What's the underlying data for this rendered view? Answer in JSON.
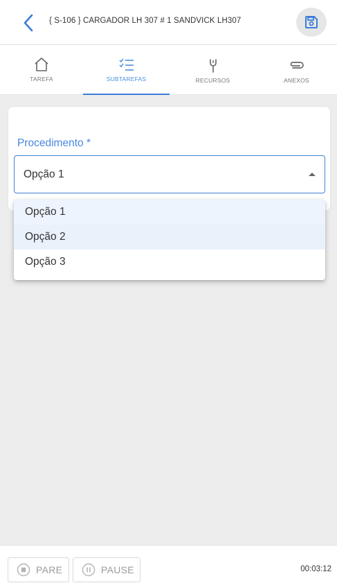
{
  "header": {
    "title": "{ S-106 } CARGADOR LH 307 # 1 SANDVICK LH307"
  },
  "tabs": [
    {
      "label": "TAREFA",
      "icon": "home-icon"
    },
    {
      "label": "SUBTAREFAS",
      "icon": "checklist-icon"
    },
    {
      "label": "RECURSOS",
      "icon": "wrench-icon"
    },
    {
      "label": "ANEXOS",
      "icon": "paperclip-icon"
    }
  ],
  "active_tab": "SUBTAREFAS",
  "form": {
    "procedure_label": "Procedimento *",
    "procedure_value": "Opção 1",
    "options": [
      "Opção 1",
      "Opção 2",
      "Opção 3"
    ]
  },
  "footer": {
    "stop_label": "PARE",
    "pause_label": "PAUSE",
    "timer": "00:03:12"
  },
  "colors": {
    "accent": "#3b7dd8",
    "label_blue": "#4a87de",
    "background": "#ededed"
  }
}
